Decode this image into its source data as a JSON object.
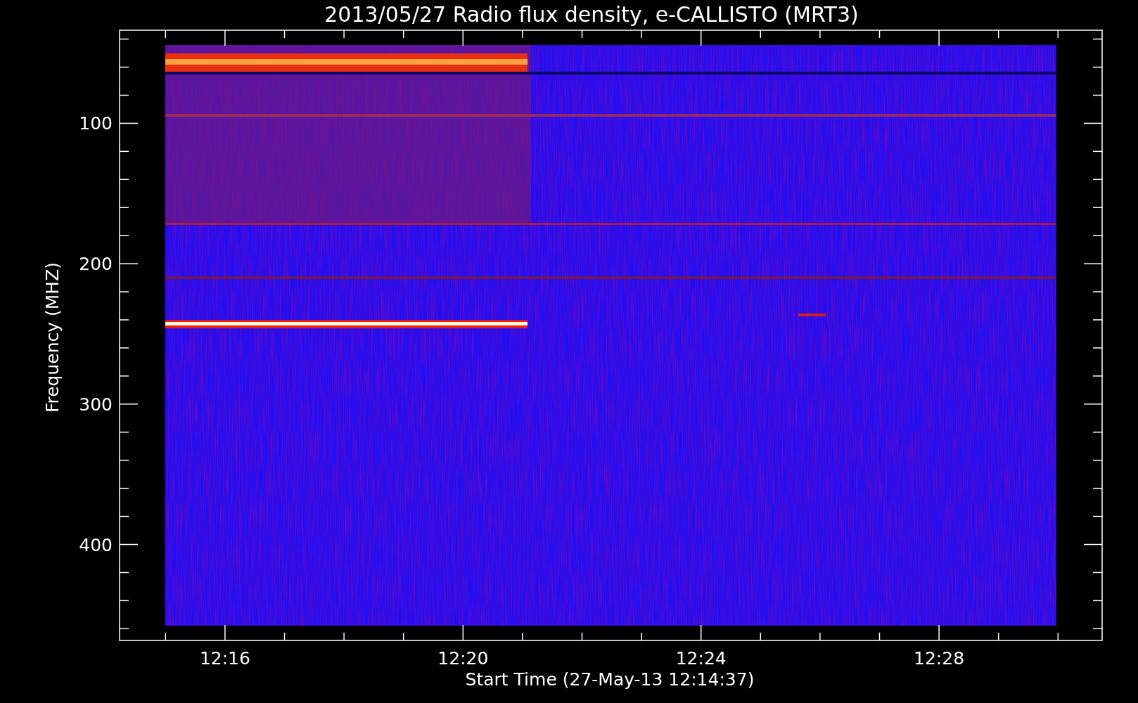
{
  "title": "2013/05/27  Radio flux density, e-CALLISTO (MRT3)",
  "plot": {
    "ylabel": "Frequency (MHZ)",
    "xlabel": "Start Time (27-May-13 12:14:37)",
    "y_tick_labels": [
      "100",
      "200",
      "300",
      "400"
    ],
    "x_tick_labels": [
      "12:16",
      "12:20",
      "12:24",
      "12:28"
    ]
  }
}
